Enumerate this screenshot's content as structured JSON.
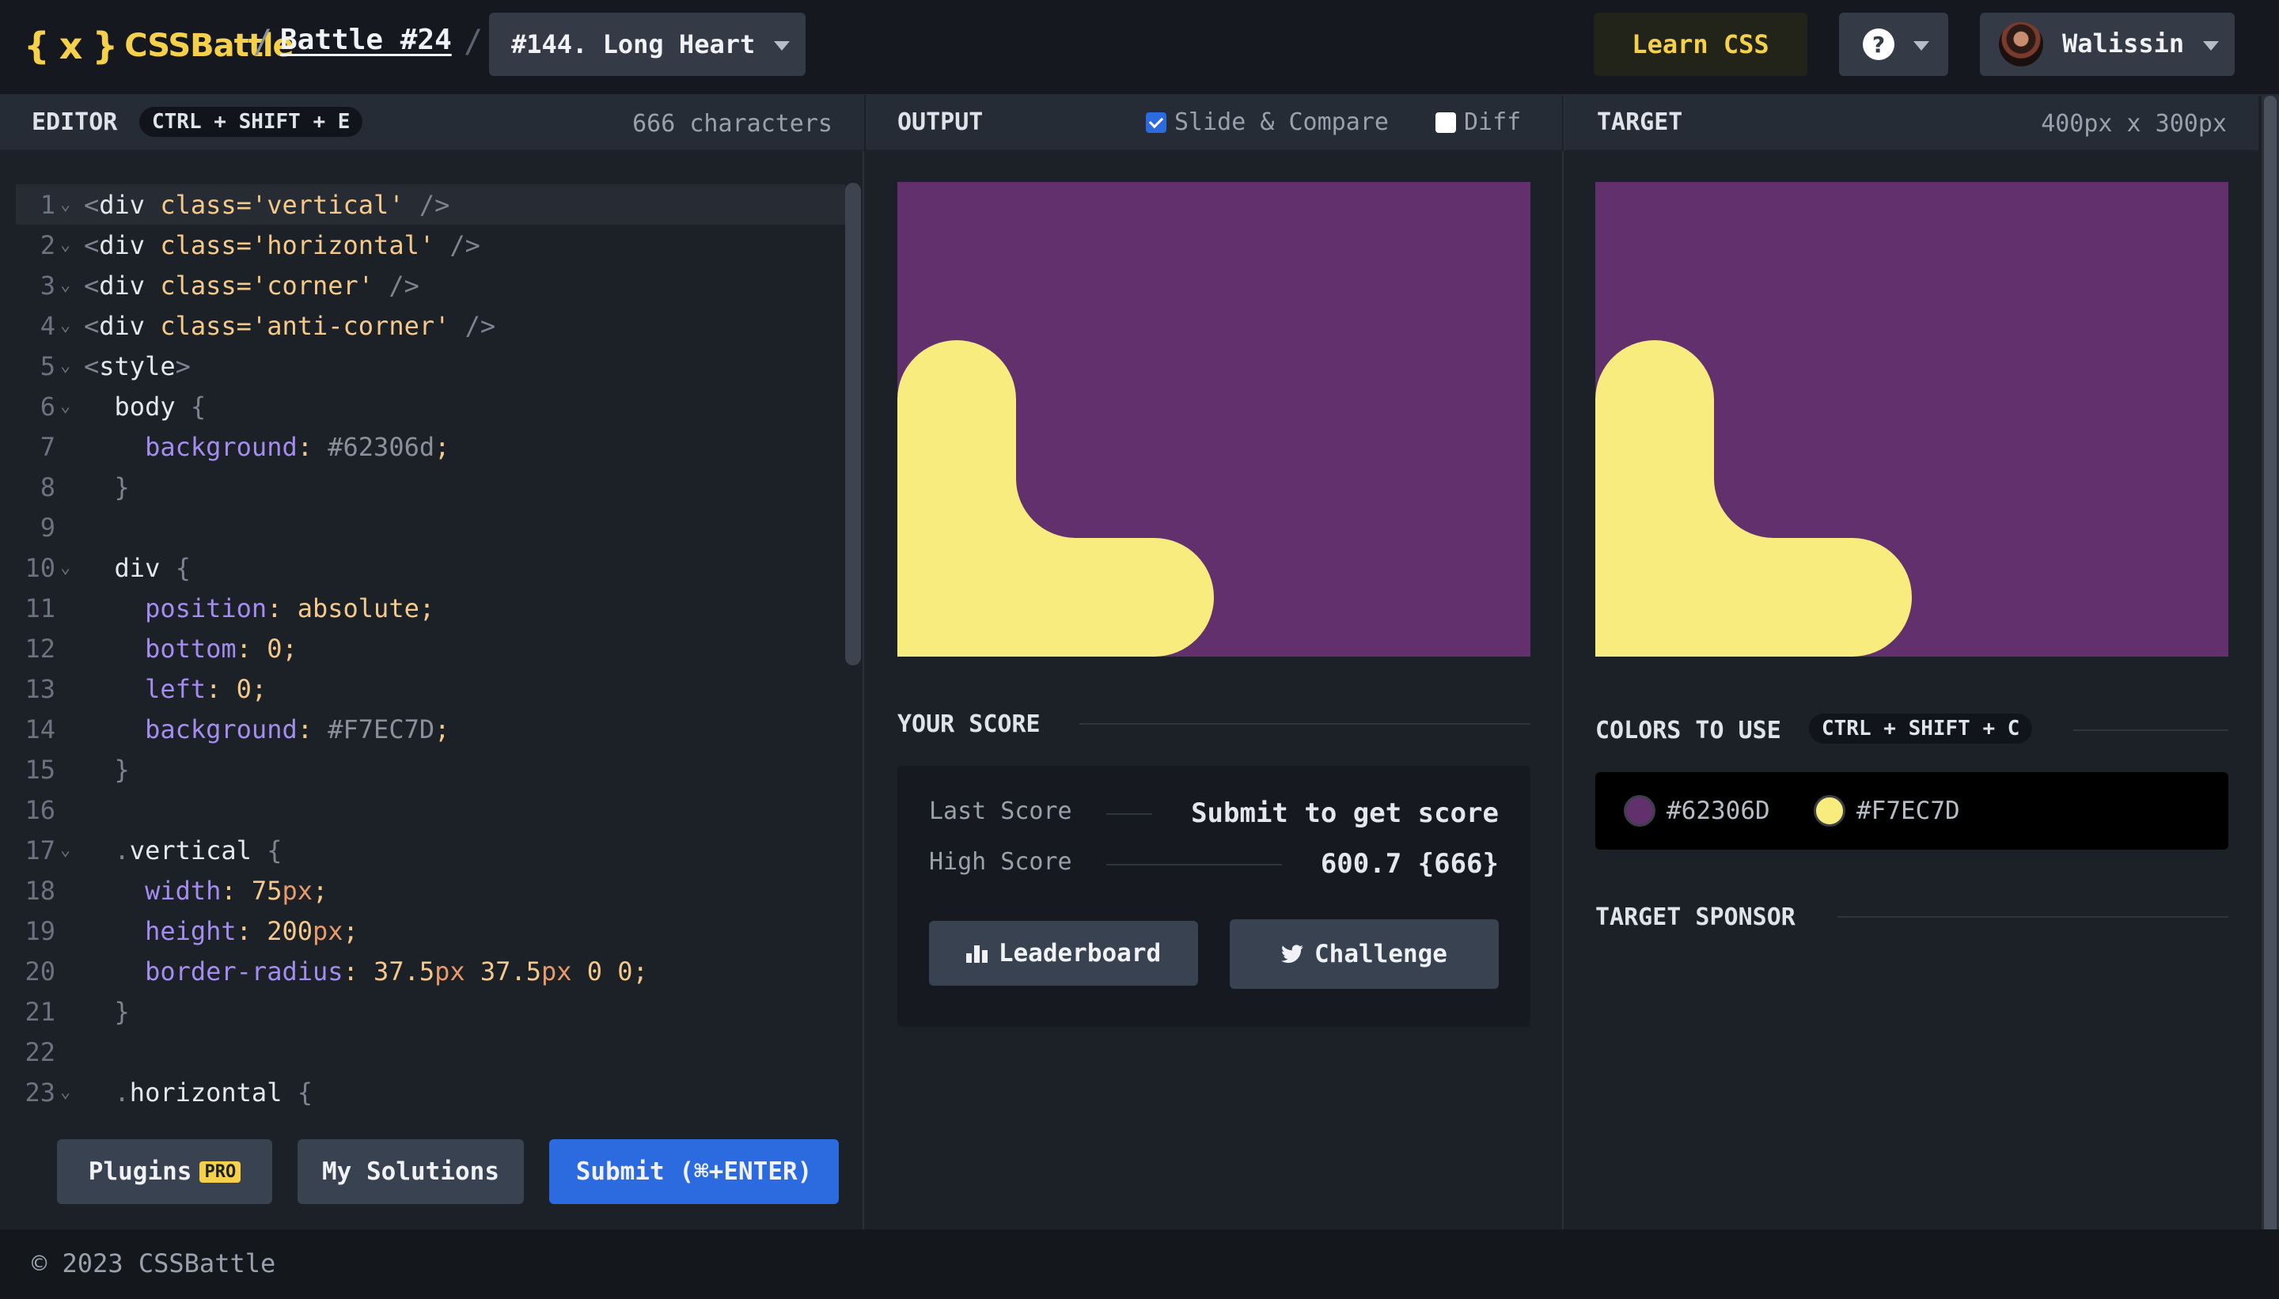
{
  "header": {
    "logo_braces": "{ x }",
    "logo_text": "CSSBattle",
    "separator": "/",
    "battle_label": "Battle #24",
    "separator2": "/",
    "target_select": "#144. Long Heart",
    "learn_label": "Learn CSS",
    "help_label": "?",
    "user_name": "Walissin"
  },
  "editor": {
    "title": "EDITOR",
    "shortcut": "CTRL + SHIFT + E",
    "char_count": "666 characters",
    "plugins_label": "Plugins",
    "pro_badge": "PRO",
    "solutions_label": "My Solutions",
    "submit_label": "Submit (⌘+ENTER)"
  },
  "output": {
    "title": "OUTPUT",
    "slide_compare_label": "Slide & Compare",
    "slide_compare_checked": true,
    "diff_label": "Diff",
    "diff_checked": false,
    "score_title": "YOUR SCORE",
    "last_score_label": "Last Score",
    "last_score_value": "Submit to get score",
    "high_score_label": "High Score",
    "high_score_value": "600.7 {666}",
    "leaderboard_label": "Leaderboard",
    "challenge_label": "Challenge"
  },
  "target": {
    "title": "TARGET",
    "size": "400px x 300px",
    "colors_title": "COLORS TO USE",
    "colors_shortcut": "CTRL + SHIFT + C",
    "colors": [
      {
        "hex": "#62306D",
        "color": "#62306d"
      },
      {
        "hex": "#F7EC7D",
        "color": "#F7EC7D"
      }
    ],
    "sponsor_title": "TARGET SPONSOR"
  },
  "footer": {
    "copyright": "© 2023 CSSBattle"
  }
}
